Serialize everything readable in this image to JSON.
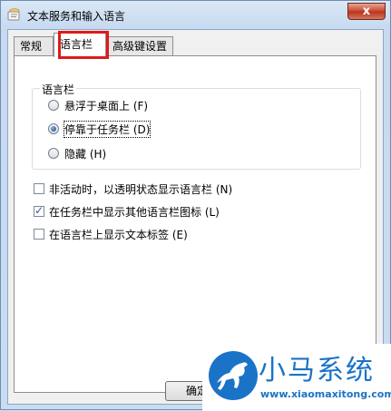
{
  "window": {
    "title": "文本服务和输入语言",
    "close_glyph": "x",
    "icon": "input-language-icon"
  },
  "tabs": [
    {
      "label": "常规",
      "active": false
    },
    {
      "label": "语言栏",
      "active": true
    },
    {
      "label": "高级键设置",
      "active": false
    }
  ],
  "highlight_color": "#e0191b",
  "language_bar_group": {
    "title": "语言栏",
    "options": [
      {
        "label": "悬浮于桌面上 (F)",
        "selected": false
      },
      {
        "label": "停靠于任务栏 (D)",
        "selected": true
      },
      {
        "label": "隐藏 (H)",
        "selected": false
      }
    ]
  },
  "checkboxes": [
    {
      "label": "非活动时，以透明状态显示语言栏 (N)",
      "checked": false
    },
    {
      "label": "在任务栏中显示其他语言栏图标 (L)",
      "checked": true
    },
    {
      "label": "在语言栏上显示文本标签 (E)",
      "checked": false
    }
  ],
  "ok_button": "确定",
  "watermark": {
    "brand": "小马系统",
    "url": "www.xiaomaxitong.com",
    "logo_icon": "horse-icon"
  }
}
